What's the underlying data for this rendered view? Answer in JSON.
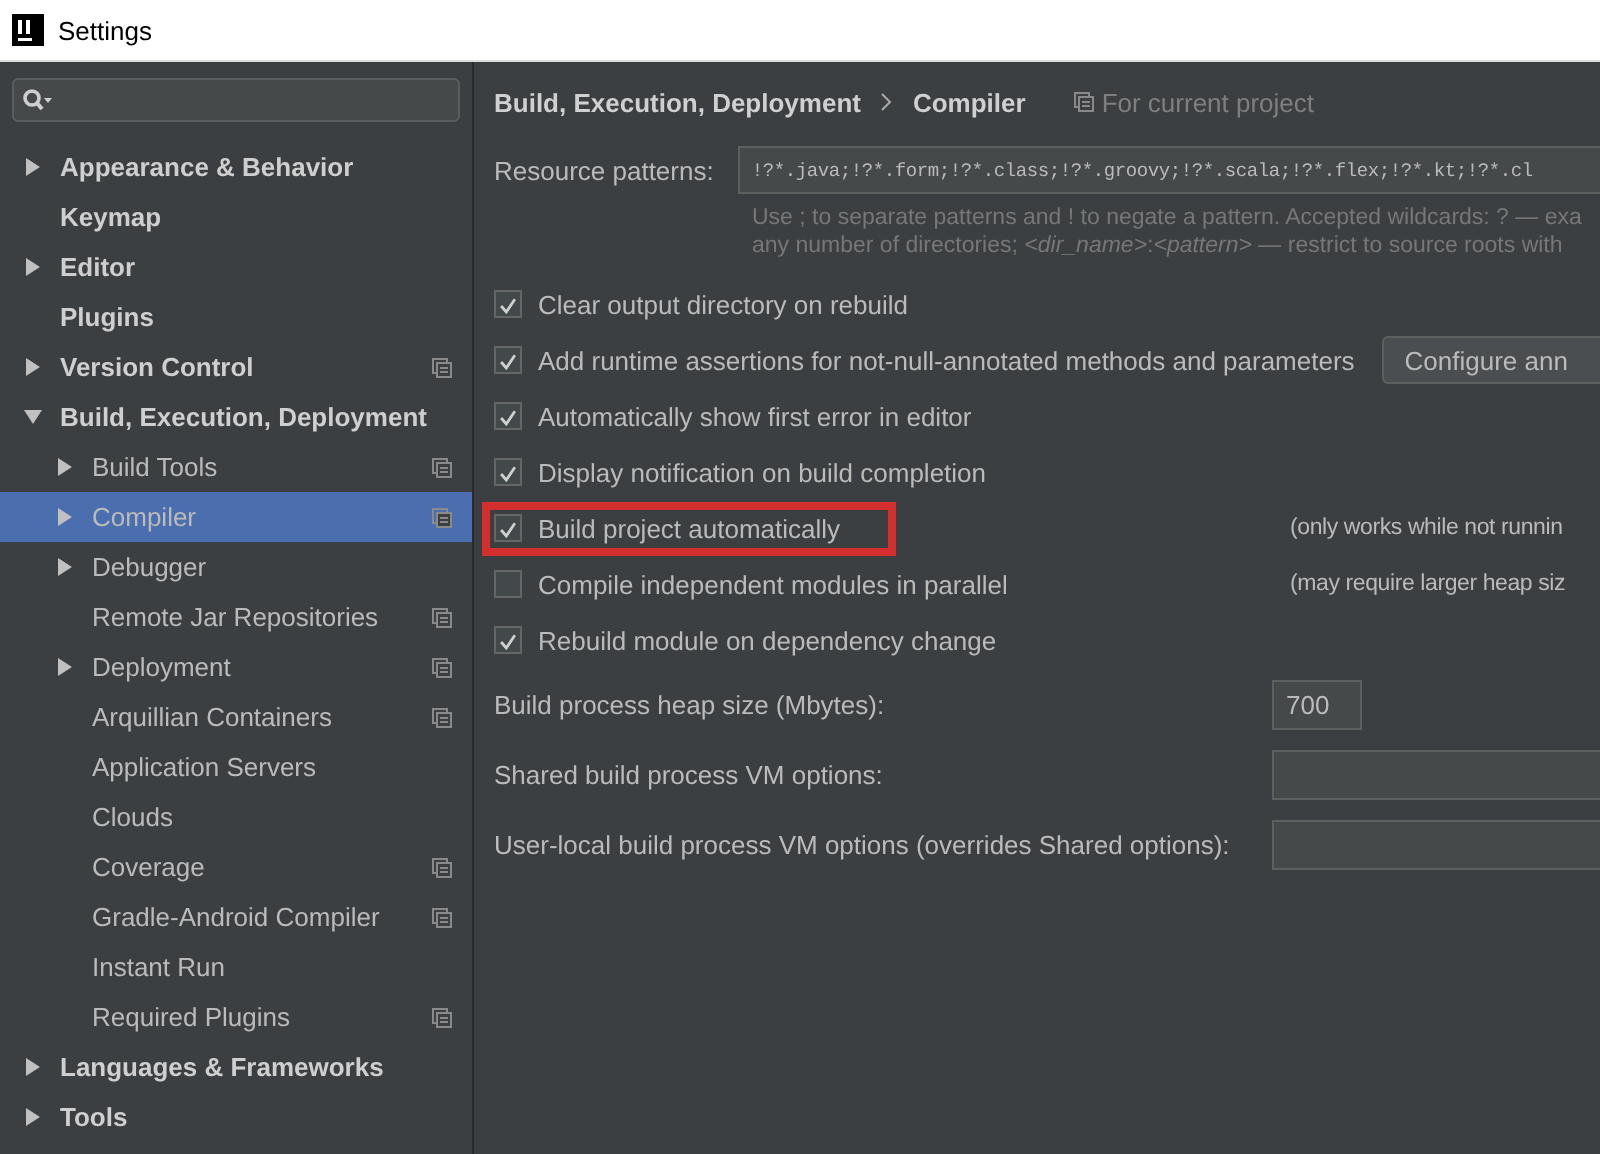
{
  "window": {
    "title": "Settings"
  },
  "sidebar": {
    "items": [
      {
        "label": "Appearance & Behavior",
        "expanded": false,
        "selected": false,
        "project_level": false
      },
      {
        "label": "Keymap",
        "selected": false,
        "project_level": false
      },
      {
        "label": "Editor",
        "expanded": false,
        "selected": false,
        "project_level": false
      },
      {
        "label": "Plugins",
        "selected": false,
        "project_level": false
      },
      {
        "label": "Version Control",
        "expanded": false,
        "selected": false,
        "project_level": true
      },
      {
        "label": "Build, Execution, Deployment",
        "expanded": true,
        "selected": false,
        "project_level": false,
        "children": [
          {
            "label": "Build Tools",
            "expanded": false,
            "selected": false,
            "project_level": true
          },
          {
            "label": "Compiler",
            "expanded": false,
            "selected": true,
            "project_level": true
          },
          {
            "label": "Debugger",
            "expanded": false,
            "selected": false,
            "project_level": false
          },
          {
            "label": "Remote Jar Repositories",
            "selected": false,
            "project_level": true
          },
          {
            "label": "Deployment",
            "expanded": false,
            "selected": false,
            "project_level": true
          },
          {
            "label": "Arquillian Containers",
            "selected": false,
            "project_level": true
          },
          {
            "label": "Application Servers",
            "selected": false,
            "project_level": false
          },
          {
            "label": "Clouds",
            "selected": false,
            "project_level": false
          },
          {
            "label": "Coverage",
            "selected": false,
            "project_level": true
          },
          {
            "label": "Gradle-Android Compiler",
            "selected": false,
            "project_level": true
          },
          {
            "label": "Instant Run",
            "selected": false,
            "project_level": false
          },
          {
            "label": "Required Plugins",
            "selected": false,
            "project_level": true
          }
        ]
      },
      {
        "label": "Languages & Frameworks",
        "expanded": false,
        "selected": false,
        "project_level": false
      },
      {
        "label": "Tools",
        "expanded": false,
        "selected": false,
        "project_level": false
      }
    ]
  },
  "panel": {
    "breadcrumb": [
      "Build, Execution, Deployment",
      "Compiler"
    ],
    "scope": "For current project",
    "resource_patterns": {
      "label": "Resource patterns:",
      "value": "!?*.java;!?*.form;!?*.class;!?*.groovy;!?*.scala;!?*.flex;!?*.kt;!?*.cl",
      "hint": [
        "Use ; to separate patterns and ! to negate a pattern. Accepted wildcards: ? — exa",
        "any number of directories; *<dir_name>*:*<pattern>* — restrict to source roots with"
      ]
    },
    "options": [
      {
        "label": "Clear output directory on rebuild",
        "checked": true,
        "highlighted": false
      },
      {
        "label": "Add runtime assertions for not-null-annotated methods and parameters",
        "checked": true,
        "highlighted": false,
        "button": "Configure ann"
      },
      {
        "label": "Automatically show first error in editor",
        "checked": true,
        "highlighted": false
      },
      {
        "label": "Display notification on build completion",
        "checked": true,
        "highlighted": false
      },
      {
        "label": "Build project automatically",
        "checked": true,
        "highlighted": true,
        "note": "(only works while not runnin"
      },
      {
        "label": "Compile independent modules in parallel",
        "checked": false,
        "highlighted": false,
        "note": "(may require larger heap siz"
      },
      {
        "label": "Rebuild module on dependency change",
        "checked": true,
        "highlighted": false
      }
    ],
    "fields": [
      {
        "label": "Build process heap size (Mbytes):",
        "value": "700",
        "kind": "short"
      },
      {
        "label": "Shared build process VM options:",
        "kind": "wide"
      },
      {
        "label": "User-local build process VM options (overrides Shared options):",
        "kind": "wide"
      }
    ]
  }
}
